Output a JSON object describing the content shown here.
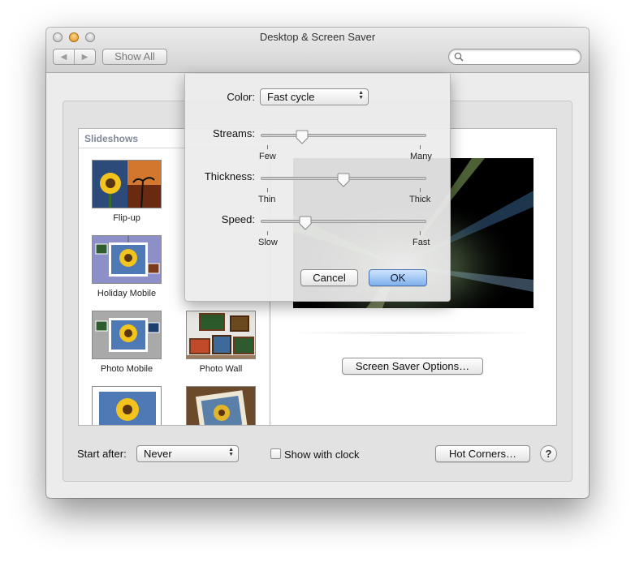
{
  "window": {
    "title": "Desktop & Screen Saver"
  },
  "toolbar": {
    "back_icon": "chevron-left-icon",
    "forward_icon": "chevron-right-icon",
    "show_all_label": "Show All",
    "search_value": "",
    "search_icon": "search-icon"
  },
  "slideshows": {
    "header": "Slideshows",
    "items": [
      {
        "label": "Flip-up"
      },
      {
        "label": "Holiday Mobile"
      },
      {
        "label": "Photo Mobile"
      },
      {
        "label": "Photo Wall"
      }
    ]
  },
  "preview": {
    "options_button_label": "Screen Saver Options…"
  },
  "bottom": {
    "start_after_label": "Start after:",
    "start_after_value": "Never",
    "show_with_clock_label": "Show with clock",
    "show_with_clock_checked": false,
    "hot_corners_label": "Hot Corners…",
    "help_label": "?"
  },
  "options_sheet": {
    "color_label": "Color:",
    "color_value": "Fast cycle",
    "sliders": [
      {
        "label": "Streams:",
        "min_label": "Few",
        "max_label": "Many",
        "value_fraction": 0.25
      },
      {
        "label": "Thickness:",
        "min_label": "Thin",
        "max_label": "Thick",
        "value_fraction": 0.5
      },
      {
        "label": "Speed:",
        "min_label": "Slow",
        "max_label": "Fast",
        "value_fraction": 0.27
      }
    ],
    "cancel_label": "Cancel",
    "ok_label": "OK"
  },
  "colors": {
    "accent": "#7fb0ec",
    "preview_background": "#000000"
  }
}
